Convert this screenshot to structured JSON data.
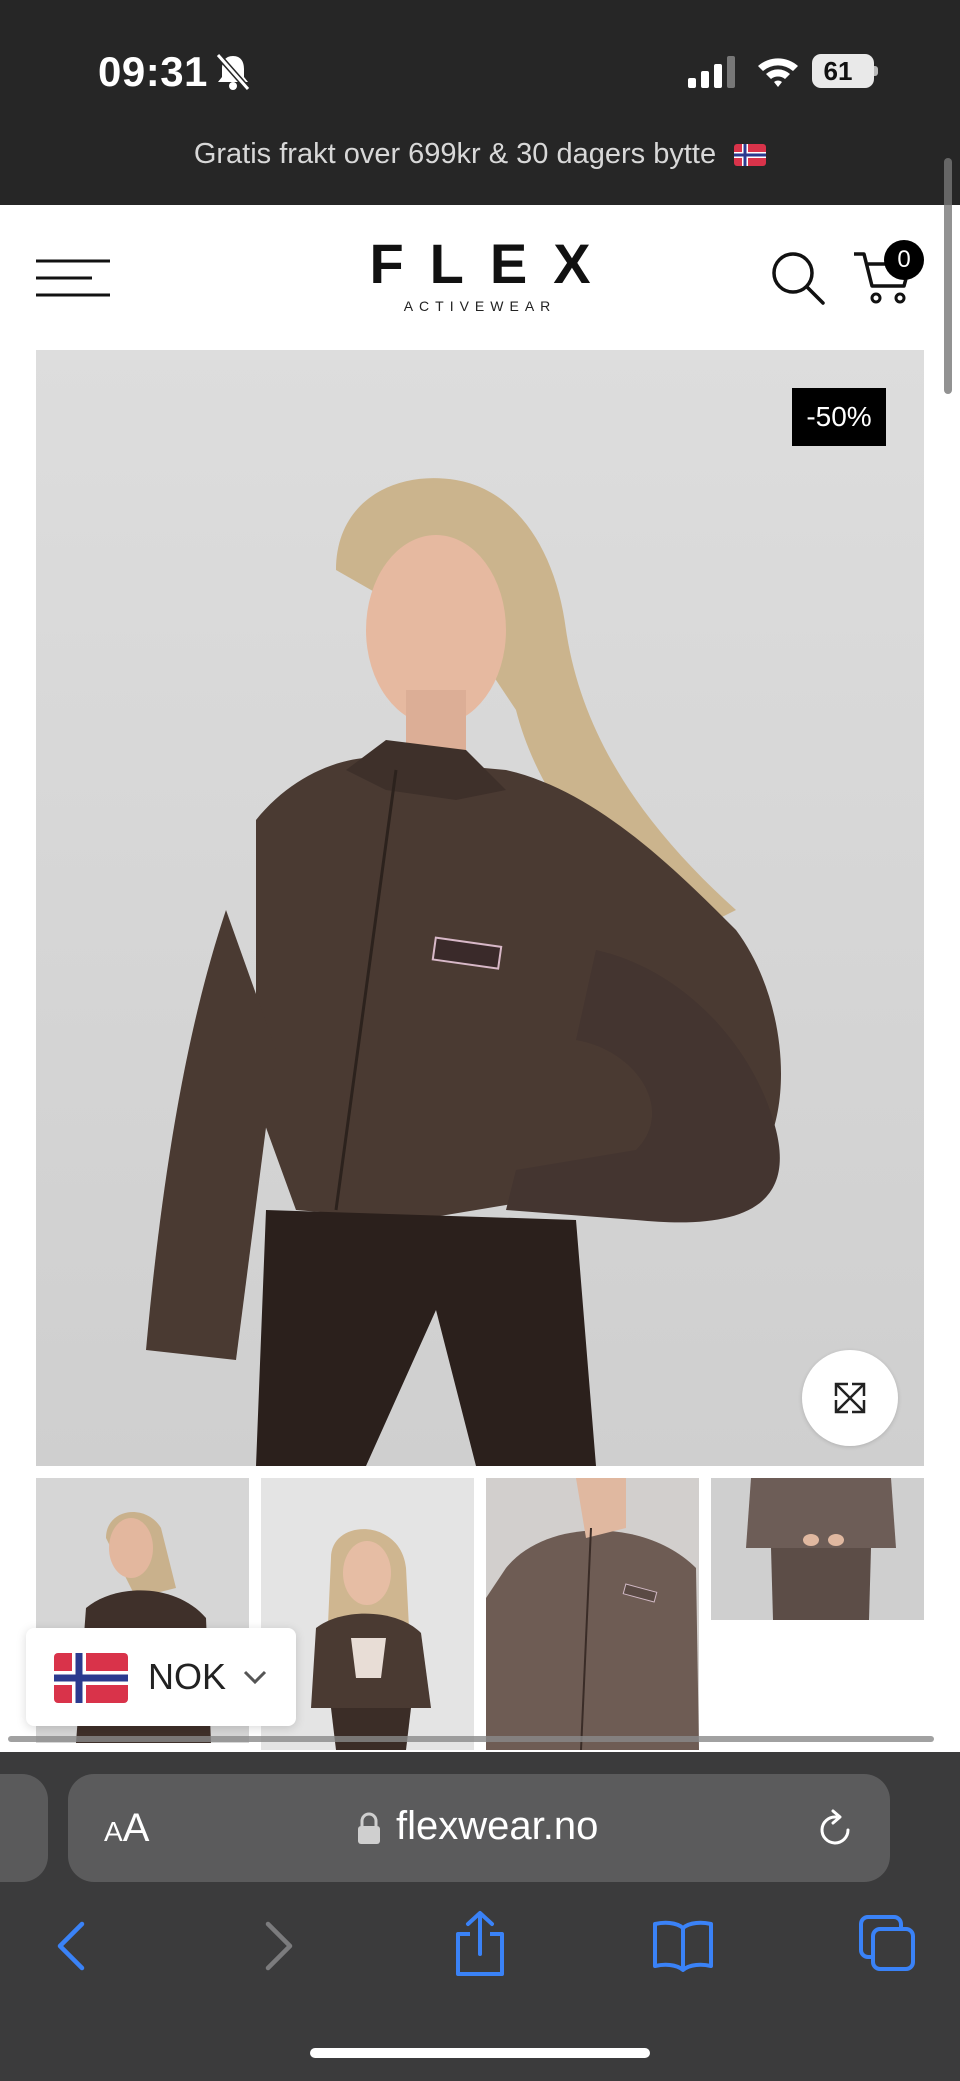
{
  "status_bar": {
    "time": "09:31",
    "battery": "61"
  },
  "promo": {
    "text": "Gratis frakt over 699kr & 30 dagers bytte"
  },
  "header": {
    "logo_main": "FLEX",
    "logo_sub": "ACTIVEWEAR",
    "cart_count": "0"
  },
  "product": {
    "discount_badge": "-50%"
  },
  "currency": {
    "selected": "NOK"
  },
  "browser": {
    "aa_large": "A",
    "aa_small": "A",
    "url": "flexwear.no"
  },
  "colors": {
    "accent": "#3a82f7",
    "top_bar": "#262626",
    "chrome": "#3b3b3c"
  },
  "icons": [
    "bell-off-icon",
    "signal-icon",
    "wifi-icon",
    "battery-icon",
    "norway-flag-icon",
    "menu-icon",
    "search-icon",
    "cart-icon",
    "expand-icon",
    "chevron-down-icon",
    "lock-icon",
    "reload-icon",
    "back-icon",
    "forward-icon",
    "share-icon",
    "bookmarks-icon",
    "tabs-icon"
  ]
}
